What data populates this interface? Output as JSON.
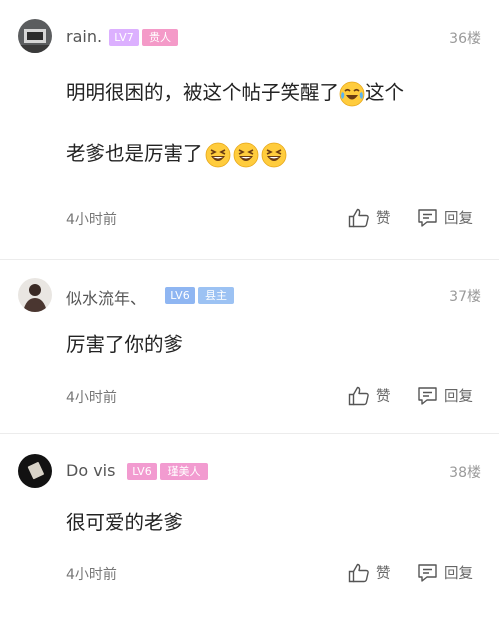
{
  "comments": [
    {
      "username": "rain.",
      "level": "LV7",
      "title": "贵人",
      "floor": "36楼",
      "text_line1_a": "明明很困的，被这个帖子笑醒了",
      "text_line1_b": "这个",
      "text_line2": "老爹也是厉害了",
      "time": "4小时前",
      "like_label": "赞",
      "reply_label": "回复",
      "level_color": "#dcb0ff",
      "title_color": "#f49ac8",
      "emojis": [
        "tears-of-joy",
        "grinning-squint",
        "grinning-squint",
        "grinning-squint"
      ]
    },
    {
      "username": "似水流年、",
      "level": "LV6",
      "title": "县主",
      "floor": "37楼",
      "text": "厉害了你的爹",
      "time": "4小时前",
      "like_label": "赞",
      "reply_label": "回复",
      "level_color": "#8fb6f2",
      "title_color": "#9cc2f3"
    },
    {
      "username": "Do vis",
      "level": "LV6",
      "title": "瑾美人",
      "floor": "38楼",
      "text": "很可爱的老爹",
      "time": "4小时前",
      "like_label": "赞",
      "reply_label": "回复",
      "level_color": "#f29bd0",
      "title_color": "#f29bd0"
    }
  ]
}
